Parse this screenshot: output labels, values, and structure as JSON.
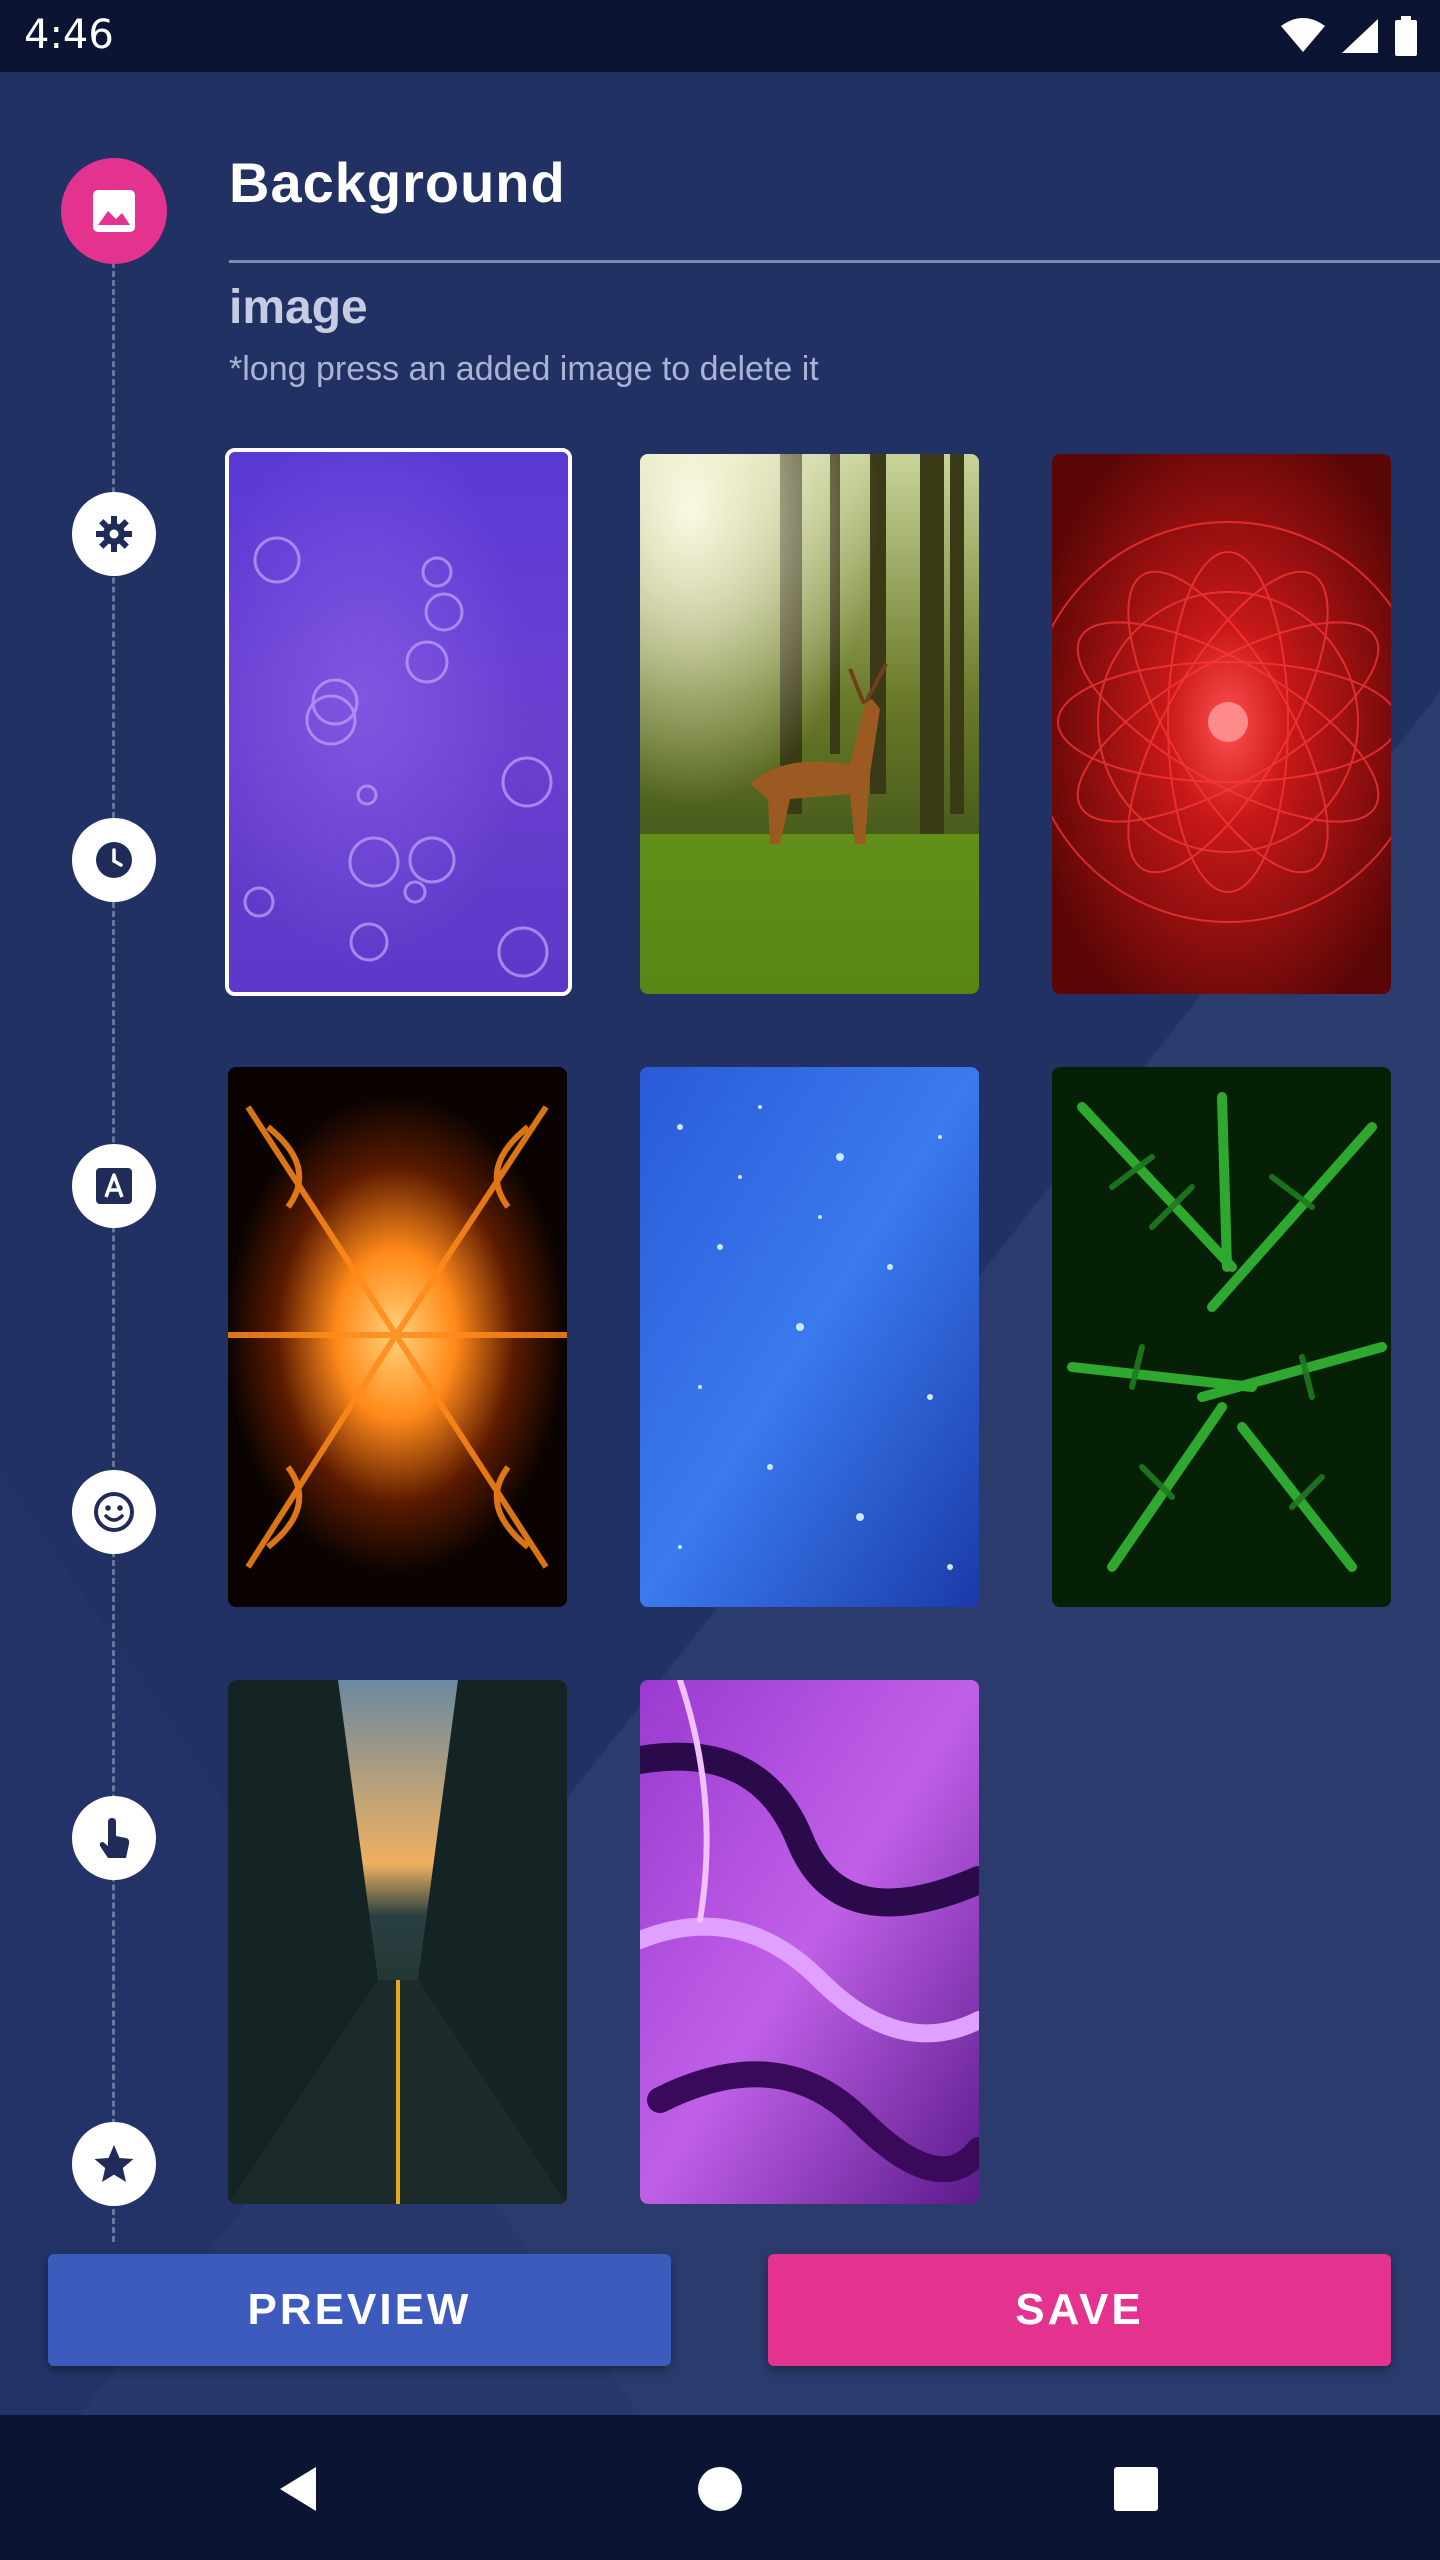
{
  "status_bar": {
    "time": "4:46",
    "icons": [
      "wifi-icon",
      "cellular-signal-icon",
      "battery-icon"
    ]
  },
  "header": {
    "title": "Background",
    "section_label": "image",
    "hint": "*long press an added image to delete it"
  },
  "rail": {
    "steps": [
      {
        "icon": "image-icon",
        "active": true
      },
      {
        "icon": "gear-icon",
        "active": false
      },
      {
        "icon": "clock-icon",
        "active": false
      },
      {
        "icon": "text-icon",
        "active": false
      },
      {
        "icon": "smiley-icon",
        "active": false
      },
      {
        "icon": "touch-icon",
        "active": false
      },
      {
        "icon": "star-icon",
        "active": false
      }
    ]
  },
  "wallpapers": [
    {
      "name": "purple-bubbles",
      "selected": true
    },
    {
      "name": "forest-deer",
      "selected": false
    },
    {
      "name": "red-mandala",
      "selected": false
    },
    {
      "name": "orange-fire-kaleidoscope",
      "selected": false
    },
    {
      "name": "blue-glitter",
      "selected": false
    },
    {
      "name": "green-fern",
      "selected": false
    },
    {
      "name": "city-street",
      "selected": false
    },
    {
      "name": "purple-marble",
      "selected": false
    }
  ],
  "buttons": {
    "preview_label": "PREVIEW",
    "save_label": "SAVE"
  },
  "colors": {
    "accent": "#e3338f",
    "primary": "#3d5bbd",
    "background": "#223163",
    "status_bar": "#0b1433"
  },
  "nav_bar": {
    "icons": [
      "back-icon",
      "home-icon",
      "recents-icon"
    ]
  }
}
